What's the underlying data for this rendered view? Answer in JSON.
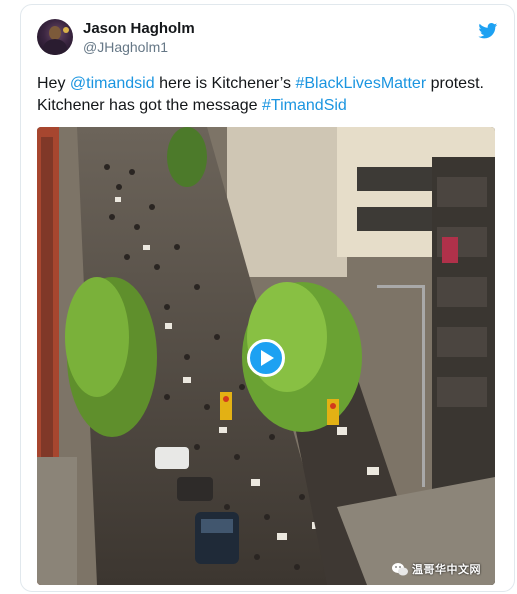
{
  "tweet": {
    "author_name": "Jason Hagholm",
    "author_handle": "@JHagholm1",
    "text_parts": [
      {
        "text": "Hey ",
        "type": "plain"
      },
      {
        "text": "@timandsid",
        "type": "link"
      },
      {
        "text": " here is Kitchener’s ",
        "type": "plain"
      },
      {
        "text": "#BlackLivesMatter",
        "type": "link"
      },
      {
        "text": " protest. Kitchener has got the message ",
        "type": "plain"
      },
      {
        "text": "#TimandSid",
        "type": "link"
      }
    ]
  },
  "media": {
    "type": "video",
    "play_icon": "play-icon"
  },
  "watermark": {
    "text": "温哥华中文网"
  },
  "colors": {
    "link": "#1b95e0",
    "twitter_blue": "#1da1f2",
    "text": "#14171a",
    "muted": "#657786",
    "border": "#e1e8ed"
  }
}
